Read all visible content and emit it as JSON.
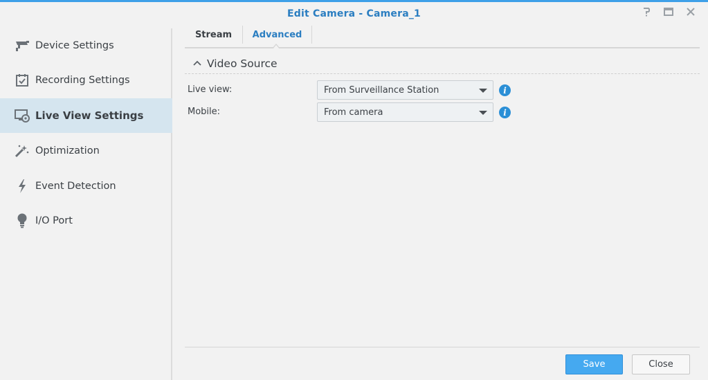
{
  "window": {
    "title": "Edit Camera - Camera_1",
    "controls": [
      "help-icon",
      "maximize-icon",
      "close-icon"
    ]
  },
  "sidebar": {
    "items": [
      {
        "label": "Device Settings",
        "icon": "camera-icon"
      },
      {
        "label": "Recording Settings",
        "icon": "calendar-check-icon"
      },
      {
        "label": "Live View Settings",
        "icon": "monitor-camera-icon",
        "active": true
      },
      {
        "label": "Optimization",
        "icon": "magic-wand-icon"
      },
      {
        "label": "Event Detection",
        "icon": "lightning-icon"
      },
      {
        "label": "I/O Port",
        "icon": "bulb-icon"
      }
    ]
  },
  "tabs": {
    "items": [
      {
        "label": "Stream"
      },
      {
        "label": "Advanced",
        "active": true
      }
    ]
  },
  "section": {
    "title": "Video Source",
    "fields": [
      {
        "label": "Live view:",
        "value": "From Surveillance Station"
      },
      {
        "label": "Mobile:",
        "value": "From camera"
      }
    ]
  },
  "footer": {
    "save_label": "Save",
    "close_label": "Close"
  },
  "colors": {
    "accent": "#2b7ec1",
    "topbar": "#3ea0e8",
    "active_bg": "#d5e5ef",
    "primary_button": "#45a9f0",
    "info": "#2b8fd6",
    "background": "#f2f2f2"
  }
}
